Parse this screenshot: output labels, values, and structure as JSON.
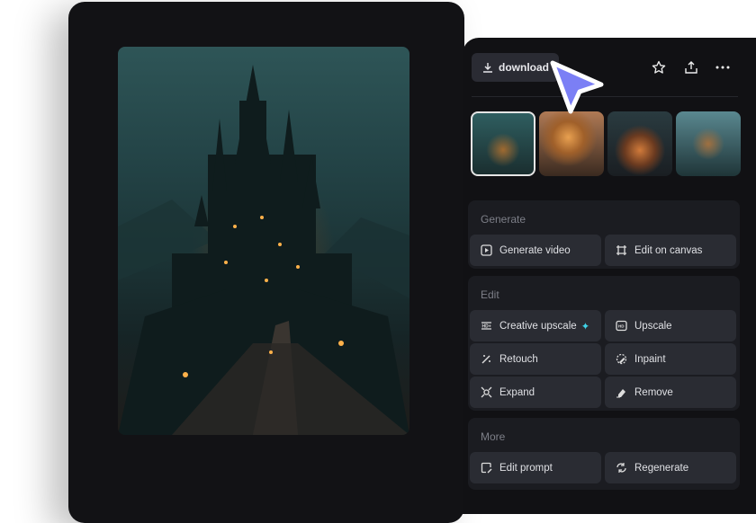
{
  "toolbar": {
    "download_label": "download",
    "icons": [
      "star-icon",
      "share-icon",
      "more-icon"
    ]
  },
  "sections": [
    {
      "title": "Generate",
      "actions": [
        {
          "label": "Generate video",
          "icon": "play-icon"
        },
        {
          "label": "Edit on canvas",
          "icon": "crop-icon"
        }
      ]
    },
    {
      "title": "Edit",
      "actions": [
        {
          "label": "Creative upscale",
          "icon": "hd-plus-icon",
          "badge": "✦"
        },
        {
          "label": "Upscale",
          "icon": "hd-icon"
        },
        {
          "label": "Retouch",
          "icon": "magic-wand-icon"
        },
        {
          "label": "Inpaint",
          "icon": "inpaint-icon"
        },
        {
          "label": "Expand",
          "icon": "expand-icon"
        },
        {
          "label": "Remove",
          "icon": "eraser-icon"
        }
      ]
    },
    {
      "title": "More",
      "actions": [
        {
          "label": "Edit prompt",
          "icon": "edit-prompt-icon"
        },
        {
          "label": "Regenerate",
          "icon": "regenerate-icon"
        }
      ]
    }
  ],
  "colors": {
    "accent": "#7b7ff5",
    "sparkle": "#3fd3e8"
  }
}
